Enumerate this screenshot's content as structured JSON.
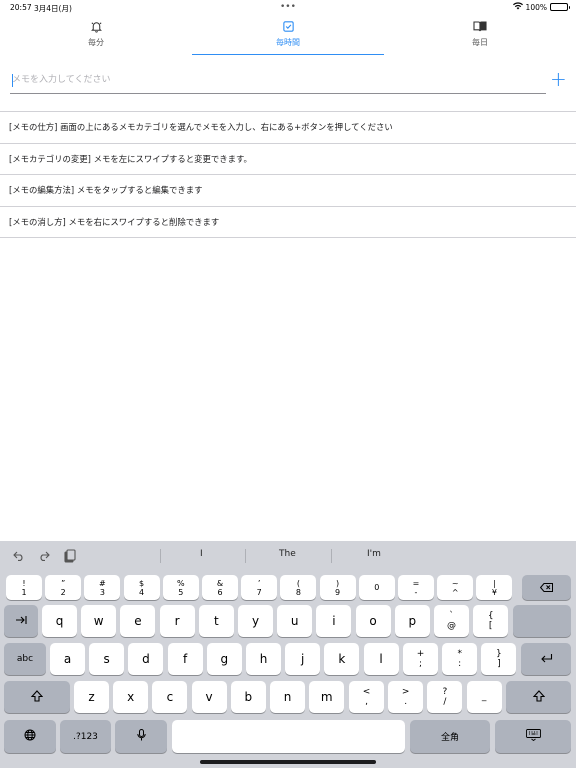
{
  "status": {
    "time": "20:57",
    "date": "3月4日(月)",
    "battery": "100%",
    "battery_level": 100
  },
  "tabs": [
    {
      "label": "毎分",
      "icon": "bell-icon",
      "active": false
    },
    {
      "label": "毎時間",
      "icon": "checklist-icon",
      "active": true
    },
    {
      "label": "毎日",
      "icon": "book-icon",
      "active": false
    }
  ],
  "input": {
    "placeholder": "メモを入力してください",
    "value": "",
    "add_label": "+"
  },
  "memos": [
    "[メモの仕方] 画面の上にあるメモカテゴリを選んでメモを入力し、右にある+ボタンを押してください",
    "[メモカテゴリの変更] メモを左にスワイプすると変更できます。",
    "[メモの編集方法] メモをタップすると編集できます",
    "[メモの消し方] メモを右にスワイプすると削除できます"
  ],
  "keyboard": {
    "suggestions": [
      "I",
      "The",
      "I'm"
    ],
    "number_row": [
      {
        "top": "!",
        "bottom": "1"
      },
      {
        "top": "”",
        "bottom": "2"
      },
      {
        "top": "#",
        "bottom": "3"
      },
      {
        "top": "$",
        "bottom": "4"
      },
      {
        "top": "%",
        "bottom": "5"
      },
      {
        "top": "&",
        "bottom": "6"
      },
      {
        "top": "’",
        "bottom": "7"
      },
      {
        "top": "(",
        "bottom": "8"
      },
      {
        "top": ")",
        "bottom": "9"
      },
      {
        "top": "",
        "bottom": "0"
      },
      {
        "top": "=",
        "bottom": "-"
      },
      {
        "top": "~",
        "bottom": "^"
      },
      {
        "top": "|",
        "bottom": "¥"
      }
    ],
    "row1": [
      "q",
      "w",
      "e",
      "r",
      "t",
      "y",
      "u",
      "i",
      "o",
      "p"
    ],
    "row1_extra": [
      {
        "top": "`",
        "bottom": "@"
      },
      {
        "top": "{",
        "bottom": "["
      }
    ],
    "row2": [
      "a",
      "s",
      "d",
      "f",
      "g",
      "h",
      "j",
      "k",
      "l"
    ],
    "row2_extra": [
      {
        "top": "+",
        "bottom": ";"
      },
      {
        "top": "*",
        "bottom": ":"
      },
      {
        "top": "}",
        "bottom": "]"
      }
    ],
    "row3": [
      "z",
      "x",
      "c",
      "v",
      "b",
      "n",
      "m"
    ],
    "row3_extra": [
      {
        "top": "<",
        "bottom": ","
      },
      {
        "top": ">",
        "bottom": "."
      },
      {
        "top": "?",
        "bottom": "/"
      },
      {
        "top": "",
        "bottom": "_"
      }
    ],
    "abc_label": "abc",
    "numbers_label": ".?123",
    "space_label": "",
    "kana_label": "全角"
  }
}
